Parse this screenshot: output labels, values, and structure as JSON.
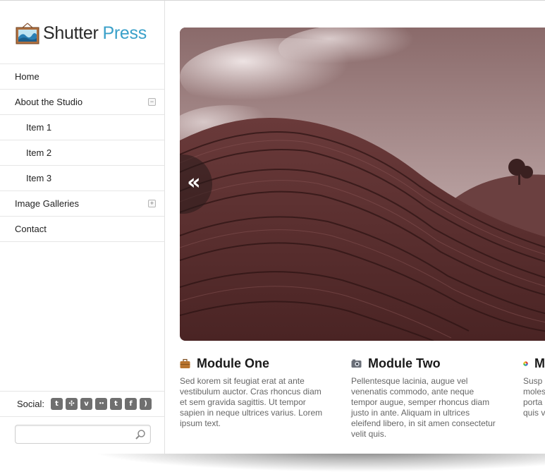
{
  "logo": {
    "word1": "Shutter",
    "word2": "Press"
  },
  "nav": {
    "items": [
      {
        "label": "Home",
        "toggle": ""
      },
      {
        "label": "About the Studio",
        "toggle": "−"
      },
      {
        "label": "Item 1",
        "toggle": ""
      },
      {
        "label": "Item 2",
        "toggle": ""
      },
      {
        "label": "Item 3",
        "toggle": ""
      },
      {
        "label": "Image Galleries",
        "toggle": "+"
      },
      {
        "label": "Contact",
        "toggle": ""
      }
    ]
  },
  "social": {
    "label": "Social:",
    "icons": [
      {
        "name": "technorati-icon",
        "glyph": "t"
      },
      {
        "name": "openid-icon",
        "glyph": "✣"
      },
      {
        "name": "vimeo-icon",
        "glyph": "v"
      },
      {
        "name": "flickr-icon",
        "glyph": "••"
      },
      {
        "name": "twitter-icon",
        "glyph": "t"
      },
      {
        "name": "facebook-icon",
        "glyph": "f"
      },
      {
        "name": "rss-icon",
        "glyph": ")"
      }
    ]
  },
  "search": {
    "placeholder": "",
    "value": ""
  },
  "slider": {
    "prev_glyph": "«"
  },
  "modules": [
    {
      "title": "Module One",
      "icon": "briefcase-icon",
      "text": "Sed korem sit feugiat erat at ante vestibulum auctor. Cras rhoncus diam et sem gravida sagittis. Ut tempor sapien in neque ultrices varius. Lorem ipsum text."
    },
    {
      "title": "Module Two",
      "icon": "camera-icon",
      "text": "Pellentesque lacinia, augue vel venenatis commodo, ante neque tempor augue, semper rhoncus diam justo in ante. Aliquam in ultrices eleifend libero, in sit amen consectetur velit quis."
    },
    {
      "title": "M",
      "icon": "color-wheel-icon",
      "text": "Susp moles porta sit an quis v"
    }
  ],
  "colors": {
    "accent": "#3aa0c9",
    "photo_tint": "#7a4a4a"
  }
}
